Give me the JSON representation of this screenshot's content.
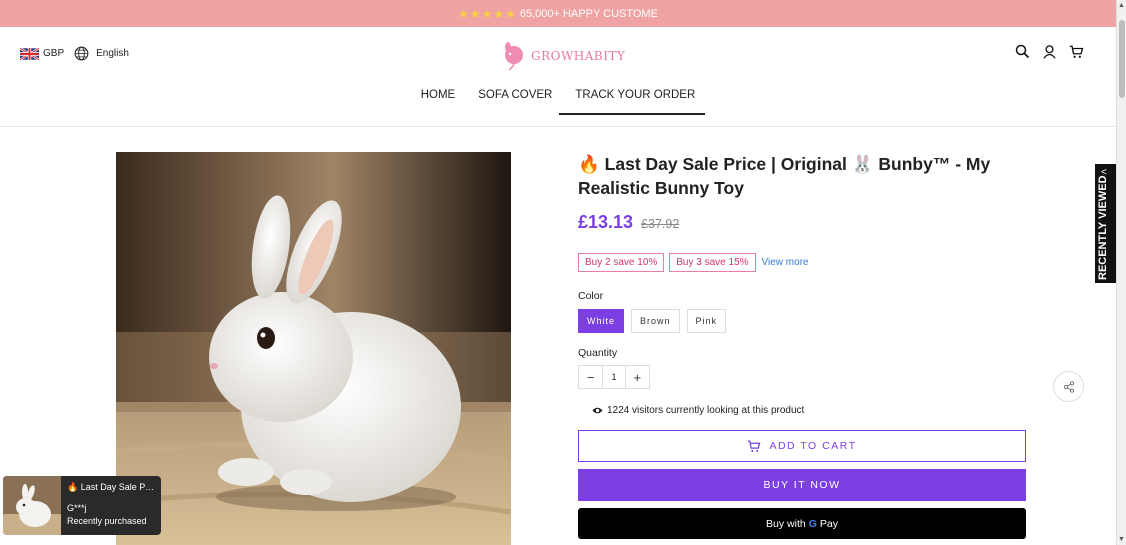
{
  "announcement": {
    "stars": "★★★★★",
    "text": "65,000+ HAPPY CUSTOME"
  },
  "header": {
    "currency": "GBP",
    "language": "English",
    "logo_text": "GROWHABITY",
    "nav": [
      "HOME",
      "SOFA COVER",
      "TRACK YOUR ORDER"
    ]
  },
  "product": {
    "title": "Last Day Sale Price | Original 🐰 Bunby™ - My Realistic Bunny Toy",
    "price": "£13.13",
    "compare_price": "£37.92",
    "offers": [
      "Buy 2 save 10%",
      "Buy 3 save 15%"
    ],
    "view_more": "View more",
    "color_label": "Color",
    "colors": [
      "White",
      "Brown",
      "Pink"
    ],
    "selected_color": "White",
    "quantity_label": "Quantity",
    "quantity": "1",
    "visitors": "1224 visitors currently looking at this product",
    "add_to_cart": "ADD TO CART",
    "buy_now": "BUY IT NOW",
    "gpay_prefix": "Buy with",
    "gpay_g": "G",
    "gpay_suffix": "Pay"
  },
  "sidebar": {
    "recently_viewed": "RECENTLY VIEWED"
  },
  "popup": {
    "title": "Last Day Sale Pr...",
    "customer": "G***j",
    "status": "Recently purchased"
  },
  "colors": {
    "accent": "#7b3fe4",
    "announce_bg": "#f0a3a3",
    "logo": "#e67ba3",
    "offer": "#d2356c"
  }
}
